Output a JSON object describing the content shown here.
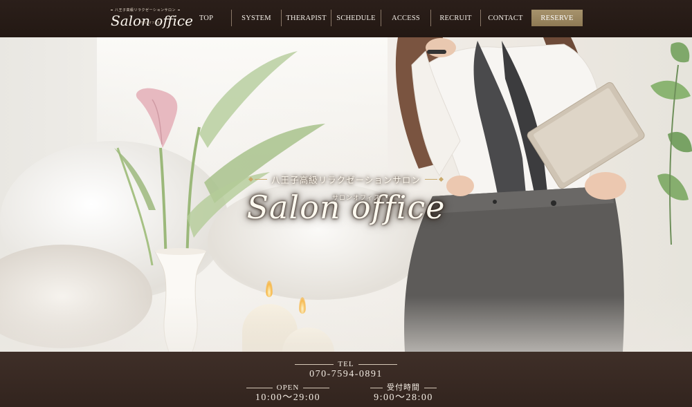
{
  "header": {
    "logo_tagline": "八王子高級リラクゼーションサロン",
    "logo_name": "Salon office",
    "logo_sub": "サロンオフィス",
    "nav": [
      {
        "label": "TOP"
      },
      {
        "label": "SYSTEM"
      },
      {
        "label": "THERAPIST"
      },
      {
        "label": "SCHEDULE"
      },
      {
        "label": "ACCESS"
      },
      {
        "label": "RECRUIT"
      },
      {
        "label": "CONTACT"
      },
      {
        "label": "RESERVE"
      }
    ]
  },
  "hero": {
    "tagline": "八王子高級リラクゼーションサロン",
    "name": "Salon office",
    "kana": "サロンオフィス"
  },
  "info": {
    "tel_label": "TEL",
    "tel_value": "070-7594-0891",
    "open_label": "OPEN",
    "open_value": "10:00～29:00",
    "reception_label": "受付時間",
    "reception_value": "9:00～28:00"
  },
  "colors": {
    "header_bg": "#2b1f1a",
    "reserve_button": "#a7936d",
    "info_bg": "#3f2f28",
    "accent_gold": "#c9a96a"
  }
}
